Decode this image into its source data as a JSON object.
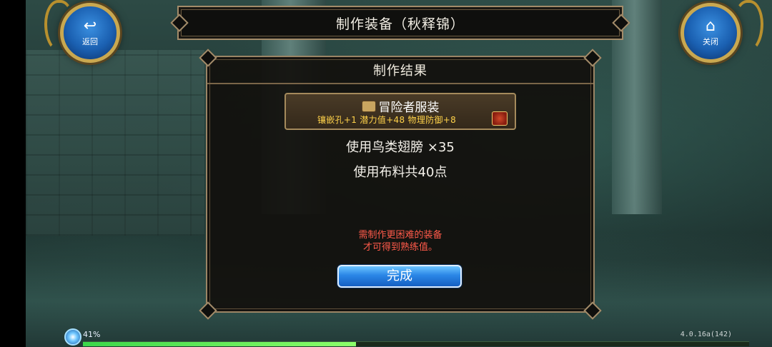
{
  "header": {
    "title": "制作装备（秋释锦）"
  },
  "buttons": {
    "back": {
      "label": "返回",
      "icon": "return-arrow-icon"
    },
    "close": {
      "label": "关闭",
      "icon": "home-icon"
    }
  },
  "panel": {
    "title": "制作结果",
    "item": {
      "name": "冒险者服装",
      "stats": "镶嵌孔+1  潜力值+48  物理防御+8"
    },
    "material_line": "使用鸟类翅膀  ×35",
    "cloth_line": "使用布料共40点",
    "notice_line1": "需制作更困难的装备",
    "notice_line2": "才可得到熟练值。",
    "done_label": "完成"
  },
  "status": {
    "progress_text": "41%",
    "progress_value": 0.41,
    "version": "4.0.16a(142)"
  },
  "colors": {
    "accent_gold": "#a38c6a",
    "notice_red": "#ff5a4a",
    "stat_yellow": "#ffd24a",
    "button_blue": "#2a86e6"
  }
}
